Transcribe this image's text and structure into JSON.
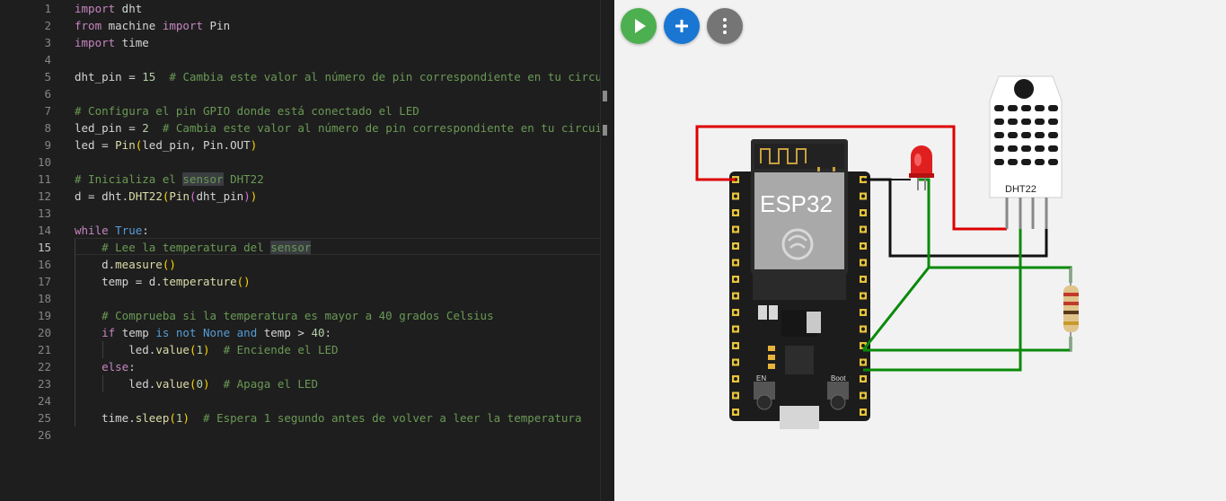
{
  "editor": {
    "lines": [
      {
        "n": "1",
        "html": "<span class='kw2'>import</span> dht"
      },
      {
        "n": "2",
        "html": "<span class='kw2'>from</span> machine <span class='kw2'>import</span> Pin"
      },
      {
        "n": "3",
        "html": "<span class='kw2'>import</span> time"
      },
      {
        "n": "4",
        "html": ""
      },
      {
        "n": "5",
        "html": "dht_pin = <span class='nm'>15</span>  <span class='cm'># Cambia este valor al número de pin correspondiente en tu circuito</span>"
      },
      {
        "n": "6",
        "html": ""
      },
      {
        "n": "7",
        "html": "<span class='cm'># Configura el pin GPIO donde está conectado el LED</span>"
      },
      {
        "n": "8",
        "html": "led_pin = <span class='nm'>2</span>  <span class='cm'># Cambia este valor al número de pin correspondiente en tu circuito</span>"
      },
      {
        "n": "9",
        "html": "led = <span class='fn'>Pin</span><span class='pr1'>(</span>led_pin, Pin.OUT<span class='pr1'>)</span>"
      },
      {
        "n": "10",
        "html": ""
      },
      {
        "n": "11",
        "html": "<span class='cm'># Inicializa el <span class='hl'>sensor</span> DHT22</span>"
      },
      {
        "n": "12",
        "html": "d = dht.<span class='fn'>DHT22</span><span class='pr1'>(</span><span class='fn'>Pin</span><span class='pr2'>(</span>dht_pin<span class='pr2'>)</span><span class='pr1'>)</span>"
      },
      {
        "n": "13",
        "html": ""
      },
      {
        "n": "14",
        "html": "<span class='kw2'>while</span> <span class='kw'>True</span>:"
      },
      {
        "n": "15",
        "html": "    <span class='cm'># Lee la temperatura del <span class='hl'>sensor</span></span>"
      },
      {
        "n": "16",
        "html": "    d.<span class='fn'>measure</span><span class='pr1'>()</span>"
      },
      {
        "n": "17",
        "html": "    temp = d.<span class='fn'>temperature</span><span class='pr1'>()</span>"
      },
      {
        "n": "18",
        "html": ""
      },
      {
        "n": "19",
        "html": "    <span class='cm'># Comprueba si la temperatura es mayor a 40 grados Celsius</span>"
      },
      {
        "n": "20",
        "html": "    <span class='kw2'>if</span> temp <span class='kw'>is not</span> <span class='kw'>None</span> <span class='kw'>and</span> temp &gt; <span class='nm'>40</span>:"
      },
      {
        "n": "21",
        "html": "        led.<span class='fn'>value</span><span class='pr1'>(</span><span class='nm'>1</span><span class='pr1'>)</span>  <span class='cm'># Enciende el LED</span>"
      },
      {
        "n": "22",
        "html": "    <span class='kw2'>else</span>:"
      },
      {
        "n": "23",
        "html": "        led.<span class='fn'>value</span><span class='pr1'>(</span><span class='nm'>0</span><span class='pr1'>)</span>  <span class='cm'># Apaga el LED</span>"
      },
      {
        "n": "24",
        "html": ""
      },
      {
        "n": "25",
        "html": "    time.<span class='fn'>sleep</span><span class='pr1'>(</span><span class='nm'>1</span><span class='pr1'>)</span>  <span class='cm'># Espera 1 segundo antes de volver a leer la temperatura</span>"
      },
      {
        "n": "26",
        "html": ""
      }
    ],
    "active_line": "15"
  },
  "toolbar": {
    "run_icon": "play-icon",
    "add_icon": "plus-icon",
    "more_icon": "more-vertical-icon",
    "colors": {
      "run": "#4caf50",
      "add": "#1976d2",
      "more": "#757575"
    }
  },
  "circuit": {
    "board_label": "ESP32",
    "sensor_label": "DHT22",
    "button_en": "EN",
    "button_boot": "Boot",
    "wire_colors": {
      "power": "#dd0000",
      "ground": "#111111",
      "signal": "#0a8a0a"
    }
  }
}
